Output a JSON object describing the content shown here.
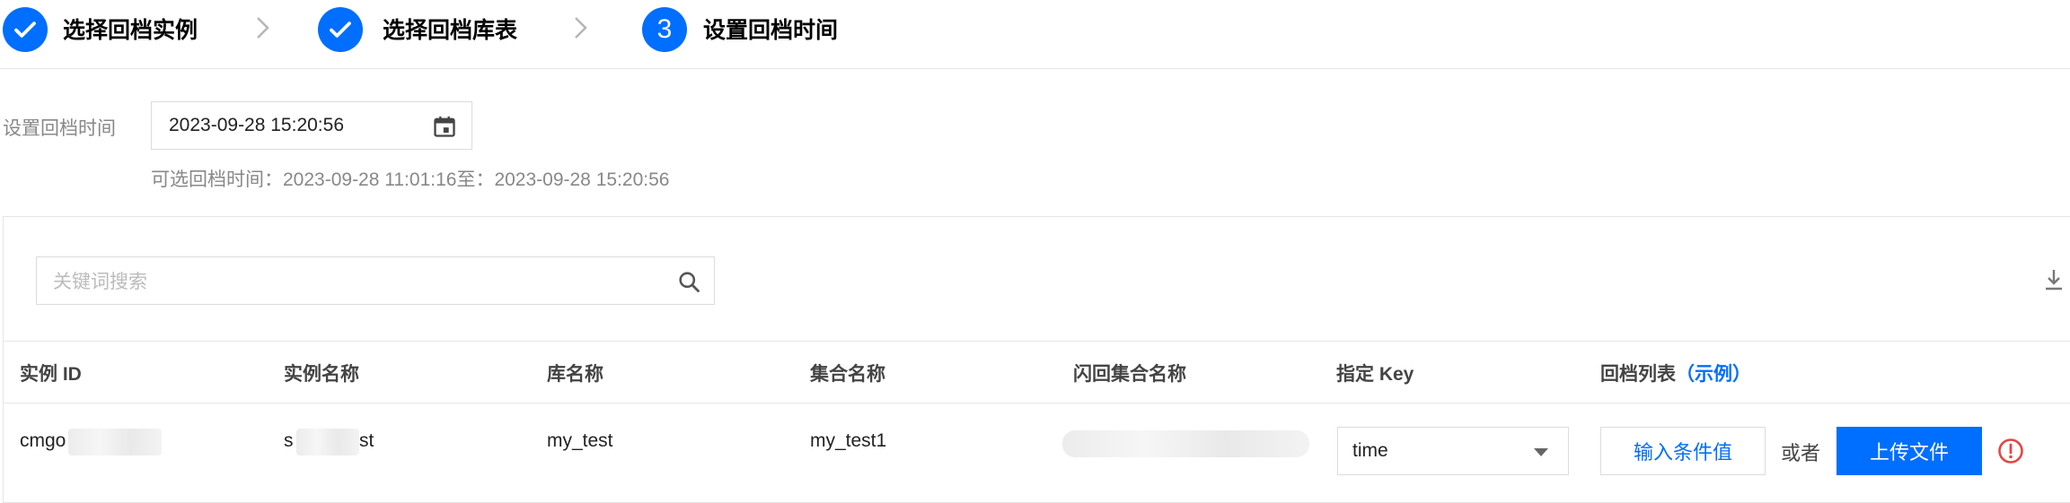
{
  "steps": [
    {
      "label": "选择回档实例",
      "state": "done"
    },
    {
      "label": "选择回档库表",
      "state": "done"
    },
    {
      "number": "3",
      "label": "设置回档时间",
      "state": "active"
    }
  ],
  "form": {
    "label": "设置回档时间",
    "date_value": "2023-09-28 15:20:56",
    "hint": "可选回档时间：2023-09-28 11:01:16至：2023-09-28 15:20:56"
  },
  "search": {
    "placeholder": "关键词搜索"
  },
  "table": {
    "headers": {
      "instance_id": "实例 ID",
      "instance_name": "实例名称",
      "db_name": "库名称",
      "collection_name": "集合名称",
      "flashback_name": "闪回集合名称",
      "key": "指定 Key",
      "rollback_list": "回档列表",
      "example_link": "（示例）"
    },
    "row": {
      "instance_id": "cmgo",
      "instance_name_start": "s",
      "instance_name_end": "st",
      "db_name": "my_test",
      "collection_name": "my_test1",
      "key_value": "time",
      "input_button": "输入条件值",
      "or_text": "或者",
      "upload_button": "上传文件"
    }
  },
  "colors": {
    "accent": "#006eff",
    "warning": "#e54545"
  },
  "icons": [
    "check-icon",
    "chevron-right-icon",
    "calendar-icon",
    "search-icon",
    "download-icon",
    "caret-down-icon",
    "warning-circle-icon"
  ]
}
